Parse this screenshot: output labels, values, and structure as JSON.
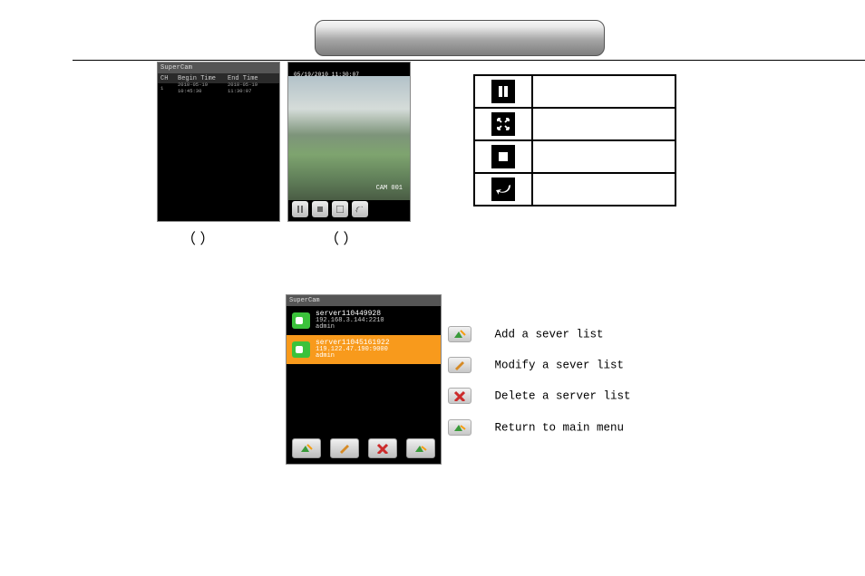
{
  "shot_a": {
    "title": "SuperCam",
    "cols": [
      "CH",
      "Begin Time",
      "End Time"
    ],
    "row": [
      "1",
      "2010-05-19 10:45:30",
      "2010-05-19 11:30:07"
    ]
  },
  "shot_b": {
    "timestamp": "05/19/2010 11:30:07",
    "cam_label": "CAM 001"
  },
  "caption_a": "（    ）",
  "caption_b": "（    ）",
  "icon_table": [
    {
      "name": "pause-icon"
    },
    {
      "name": "fullscreen-icon"
    },
    {
      "name": "stop-icon"
    },
    {
      "name": "back-icon"
    }
  ],
  "shot_c": {
    "title": "SuperCam",
    "servers": [
      {
        "name": "server110449928",
        "addr": "192.168.3.144:2210",
        "user": "admin",
        "selected": false
      },
      {
        "name": "server11045161922",
        "addr": "119.122.47.190:9000",
        "user": "admin",
        "selected": true
      }
    ]
  },
  "legend": {
    "add": "Add a sever list",
    "modify": "Modify a sever list",
    "delete": "Delete a server list",
    "return": "Return to main menu"
  }
}
